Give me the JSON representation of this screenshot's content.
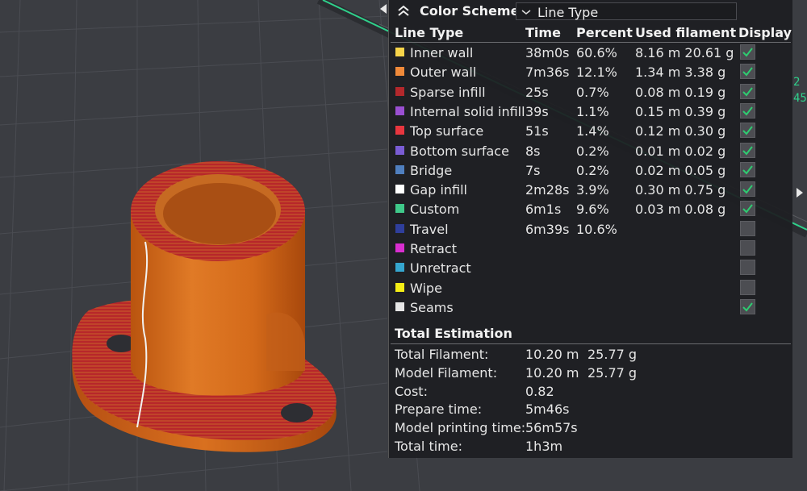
{
  "color_scheme": {
    "title": "Color Scheme",
    "selected": "Line Type"
  },
  "columns": [
    "Line Type",
    "Time",
    "Percent",
    "Used filament",
    "Display"
  ],
  "line_types": [
    {
      "name": "Inner wall",
      "color": "#f7d44a",
      "time": "38m0s",
      "percent": "60.6%",
      "filament": "8.16 m 20.61 g",
      "display": true
    },
    {
      "name": "Outer wall",
      "color": "#f08a3a",
      "time": "7m36s",
      "percent": "12.1%",
      "filament": "1.34 m 3.38 g",
      "display": true
    },
    {
      "name": "Sparse infill",
      "color": "#b3282c",
      "time": "25s",
      "percent": "0.7%",
      "filament": "0.08 m 0.19 g",
      "display": true
    },
    {
      "name": "Internal solid infill",
      "color": "#9a4fd2",
      "time": "39s",
      "percent": "1.1%",
      "filament": "0.15 m 0.39 g",
      "display": true
    },
    {
      "name": "Top surface",
      "color": "#e8363f",
      "time": "51s",
      "percent": "1.4%",
      "filament": "0.12 m 0.30 g",
      "display": true
    },
    {
      "name": "Bottom surface",
      "color": "#7a5cd4",
      "time": "8s",
      "percent": "0.2%",
      "filament": "0.01 m 0.02 g",
      "display": true
    },
    {
      "name": "Bridge",
      "color": "#4f7fbf",
      "time": "7s",
      "percent": "0.2%",
      "filament": "0.02 m 0.05 g",
      "display": true
    },
    {
      "name": "Gap infill",
      "color": "#ffffff",
      "time": "2m28s",
      "percent": "3.9%",
      "filament": "0.30 m 0.75 g",
      "display": true
    },
    {
      "name": "Custom",
      "color": "#3fc98a",
      "time": "6m1s",
      "percent": "9.6%",
      "filament": "0.03 m 0.08 g",
      "display": true
    },
    {
      "name": "Travel",
      "color": "#2f3f9c",
      "time": "6m39s",
      "percent": "10.6%",
      "filament": "",
      "display": false
    },
    {
      "name": "Retract",
      "color": "#d92ed0",
      "time": "",
      "percent": "",
      "filament": "",
      "display": false
    },
    {
      "name": "Unretract",
      "color": "#35a6cf",
      "time": "",
      "percent": "",
      "filament": "",
      "display": false
    },
    {
      "name": "Wipe",
      "color": "#f4ee16",
      "time": "",
      "percent": "",
      "filament": "",
      "display": false
    },
    {
      "name": "Seams",
      "color": "#e6e6e6",
      "time": "",
      "percent": "",
      "filament": "",
      "display": true
    }
  ],
  "total_estimation": {
    "title": "Total Estimation",
    "rows": [
      {
        "label": "Total Filament:",
        "value": "10.20 m",
        "value2": "25.77 g"
      },
      {
        "label": "Model Filament:",
        "value": "10.20 m",
        "value2": "25.77 g"
      },
      {
        "label": "Cost:",
        "value": "0.82",
        "value2": ""
      },
      {
        "label": "Prepare time:",
        "value": "5m46s",
        "value2": ""
      },
      {
        "label": "Model printing time:",
        "value": "56m57s",
        "value2": ""
      },
      {
        "label": "Total time:",
        "value": "1h3m",
        "value2": ""
      }
    ]
  },
  "edge_labels": [
    "2",
    "45"
  ],
  "colors": {
    "check": "#2ecc71",
    "model_orange": "#d8691a",
    "model_red": "#b8252a"
  },
  "icons": [
    "collapse-up-icon",
    "chevron-down-icon",
    "checkmark-icon",
    "arrow-right-icon",
    "arrow-left-icon"
  ]
}
